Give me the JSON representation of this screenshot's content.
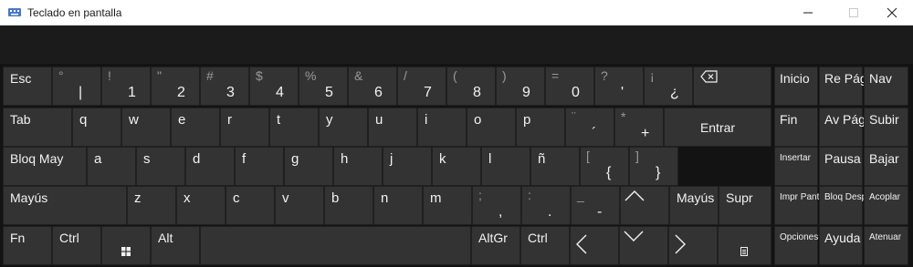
{
  "window": {
    "title": "Teclado en pantalla",
    "controls": [
      "minimize-icon",
      "maximize-icon",
      "close-icon"
    ]
  },
  "colors": {
    "key_bg": "#333333",
    "key_text": "#f2f2f2",
    "secondary_text": "#9a9a9a",
    "board_bg": "#131313",
    "title_bg": "#ffffff"
  },
  "keys": {
    "row1": [
      {
        "id": "esc",
        "main": "Esc"
      },
      {
        "id": "backtick",
        "top": "°",
        "main": "|"
      },
      {
        "id": "k1",
        "top": "!",
        "main": "1"
      },
      {
        "id": "k2",
        "top": "\"",
        "main": "2"
      },
      {
        "id": "k3",
        "top": "#",
        "main": "3"
      },
      {
        "id": "k4",
        "top": "$",
        "main": "4"
      },
      {
        "id": "k5",
        "top": "%",
        "main": "5"
      },
      {
        "id": "k6",
        "top": "&",
        "main": "6"
      },
      {
        "id": "k7",
        "top": "/",
        "main": "7"
      },
      {
        "id": "k8",
        "top": "(",
        "main": "8"
      },
      {
        "id": "k9",
        "top": ")",
        "main": "9"
      },
      {
        "id": "k0",
        "top": "=",
        "main": "0"
      },
      {
        "id": "apos",
        "top": "?",
        "main": "'"
      },
      {
        "id": "inv-q",
        "top": "¡",
        "main": "¿"
      },
      {
        "id": "backspace",
        "icon": "backspace-icon"
      }
    ],
    "row2": [
      {
        "id": "tab",
        "main": "Tab"
      },
      {
        "id": "q",
        "main": "q"
      },
      {
        "id": "w",
        "main": "w"
      },
      {
        "id": "e",
        "main": "e"
      },
      {
        "id": "r",
        "main": "r"
      },
      {
        "id": "t",
        "main": "t"
      },
      {
        "id": "y",
        "main": "y"
      },
      {
        "id": "u",
        "main": "u"
      },
      {
        "id": "i",
        "main": "i"
      },
      {
        "id": "o",
        "main": "o"
      },
      {
        "id": "p",
        "main": "p"
      },
      {
        "id": "acute",
        "top": "¨",
        "main": "´"
      },
      {
        "id": "plus",
        "top": "*",
        "main": "+"
      },
      {
        "id": "enter",
        "main": "Entrar"
      }
    ],
    "row3": [
      {
        "id": "capslock",
        "main": "Bloq May"
      },
      {
        "id": "a",
        "main": "a"
      },
      {
        "id": "s",
        "main": "s"
      },
      {
        "id": "d",
        "main": "d"
      },
      {
        "id": "f",
        "main": "f"
      },
      {
        "id": "g",
        "main": "g"
      },
      {
        "id": "h",
        "main": "h"
      },
      {
        "id": "j",
        "main": "j"
      },
      {
        "id": "k",
        "main": "k"
      },
      {
        "id": "l",
        "main": "l"
      },
      {
        "id": "ntilde",
        "main": "ñ"
      },
      {
        "id": "lbrace",
        "top": "[",
        "main": "{"
      },
      {
        "id": "rbrace",
        "top": "]",
        "main": "}"
      }
    ],
    "row4": [
      {
        "id": "lshift",
        "main": "Mayús"
      },
      {
        "id": "z",
        "main": "z"
      },
      {
        "id": "x",
        "main": "x"
      },
      {
        "id": "c",
        "main": "c"
      },
      {
        "id": "v",
        "main": "v"
      },
      {
        "id": "b",
        "main": "b"
      },
      {
        "id": "n",
        "main": "n"
      },
      {
        "id": "m",
        "main": "m"
      },
      {
        "id": "comma",
        "top": ";",
        "main": ","
      },
      {
        "id": "period",
        "top": ":",
        "main": "."
      },
      {
        "id": "minus",
        "top": "_",
        "main": "-"
      },
      {
        "id": "up",
        "icon": "arrow-up-icon"
      },
      {
        "id": "rshift",
        "main": "Mayús"
      },
      {
        "id": "supr",
        "main": "Supr"
      }
    ],
    "row5": [
      {
        "id": "fn",
        "main": "Fn"
      },
      {
        "id": "lctrl",
        "main": "Ctrl"
      },
      {
        "id": "win",
        "icon": "windows-logo-icon"
      },
      {
        "id": "alt",
        "main": "Alt"
      },
      {
        "id": "space",
        "main": ""
      },
      {
        "id": "altgr",
        "main": "AltGr"
      },
      {
        "id": "rctrl",
        "main": "Ctrl"
      },
      {
        "id": "left",
        "icon": "arrow-left-icon"
      },
      {
        "id": "down",
        "icon": "arrow-down-icon"
      },
      {
        "id": "right",
        "icon": "arrow-right-icon"
      },
      {
        "id": "menu",
        "icon": "context-menu-icon"
      }
    ],
    "side": [
      {
        "id": "inicio",
        "main": "Inicio"
      },
      {
        "id": "repag",
        "main": "Re Pág"
      },
      {
        "id": "nav",
        "main": "Nav"
      },
      {
        "id": "fin",
        "main": "Fin"
      },
      {
        "id": "avpag",
        "main": "Av Pág"
      },
      {
        "id": "subir",
        "main": "Subir"
      },
      {
        "id": "insertar",
        "main": "Insertar"
      },
      {
        "id": "pausa",
        "main": "Pausa"
      },
      {
        "id": "bajar",
        "main": "Bajar"
      },
      {
        "id": "imprpant",
        "main": "Impr Pant"
      },
      {
        "id": "bloqdespl",
        "main": "Bloq Despl"
      },
      {
        "id": "acoplar",
        "main": "Acoplar"
      },
      {
        "id": "opciones",
        "main": "Opciones"
      },
      {
        "id": "ayuda",
        "main": "Ayuda"
      },
      {
        "id": "atenuar",
        "main": "Atenuar"
      }
    ]
  }
}
